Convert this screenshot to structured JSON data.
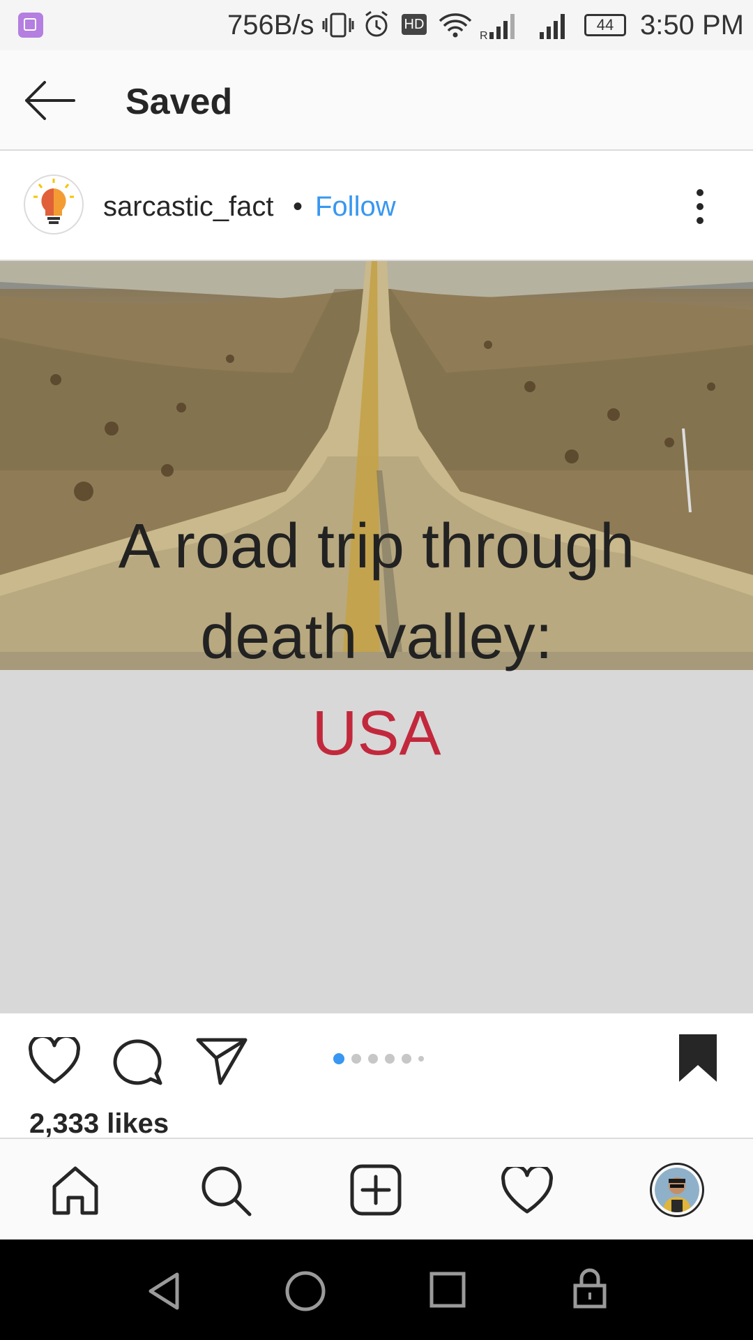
{
  "status_bar": {
    "network_speed": "756B/s",
    "hd_badge": "HD",
    "battery": "44",
    "time": "3:50 PM",
    "icons": [
      "gallery-icon",
      "vibrate-icon",
      "alarm-icon",
      "wifi-icon",
      "signal-icon"
    ]
  },
  "app_bar": {
    "title": "Saved",
    "back_icon": "arrow-left-icon"
  },
  "post": {
    "username": "sarcastic_fact",
    "separator": "•",
    "follow_label": "Follow",
    "image_text": {
      "line1": "A road trip through",
      "line2": "death valley:",
      "line3": "USA"
    },
    "carousel": {
      "count": 6,
      "active_index": 0
    },
    "likes": "2,333 likes",
    "colors": {
      "follow": "#3897f0",
      "highlight": "#c2283c",
      "dot_active": "#3897f0"
    }
  },
  "tab_bar": {
    "items": [
      "home-icon",
      "search-icon",
      "new-post-icon",
      "activity-icon",
      "profile-icon"
    ]
  },
  "system_nav": {
    "items": [
      "back-nav-icon",
      "home-nav-icon",
      "recents-nav-icon",
      "lock-nav-icon"
    ]
  }
}
